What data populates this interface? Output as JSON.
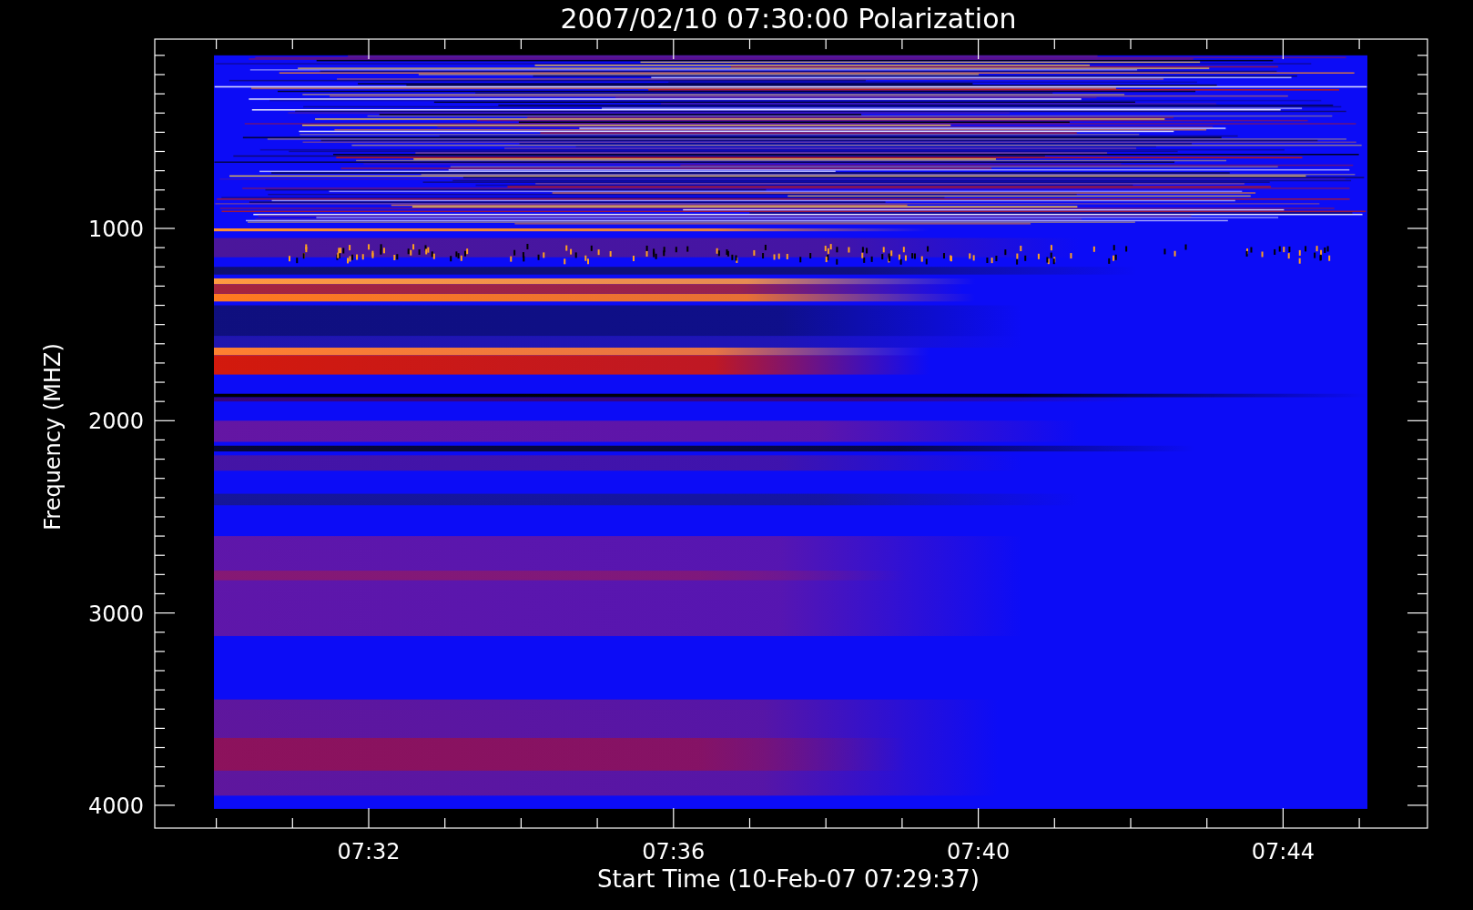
{
  "title": "2007/02/10 07:30:00 Polarization",
  "plot": {
    "ylabel": "Frequency (MHZ)",
    "yticks": [
      "1000",
      "2000",
      "3000",
      "4000"
    ],
    "xticks": [
      "07:32",
      "07:36",
      "07:40",
      "07:44"
    ],
    "xlabel": "Start Time (10-Feb-07 07:29:37)"
  }
}
